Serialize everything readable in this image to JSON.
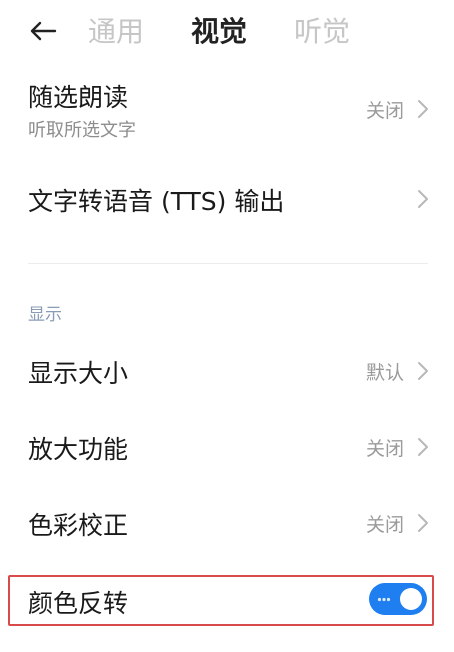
{
  "header": {
    "tabs": [
      {
        "label": "通用"
      },
      {
        "label": "视觉"
      },
      {
        "label": "听觉"
      }
    ]
  },
  "rows": {
    "select_to_speak": {
      "title": "随选朗读",
      "subtitle": "听取所选文字",
      "value": "关闭"
    },
    "tts_output": {
      "title": "文字转语音 (TTS) 输出"
    },
    "display_size": {
      "title": "显示大小",
      "value": "默认"
    },
    "magnification": {
      "title": "放大功能",
      "value": "关闭"
    },
    "color_correction": {
      "title": "色彩校正",
      "value": "关闭"
    },
    "color_inversion": {
      "title": "颜色反转",
      "enabled": true
    }
  },
  "sections": {
    "display": {
      "label": "显示"
    }
  },
  "colors": {
    "accent": "#1f7ef0",
    "highlight_border": "#d94a4a",
    "section_header": "#8a9bb5"
  },
  "icons": {
    "back": "arrow-left-icon",
    "chevron": "chevron-right-icon"
  }
}
